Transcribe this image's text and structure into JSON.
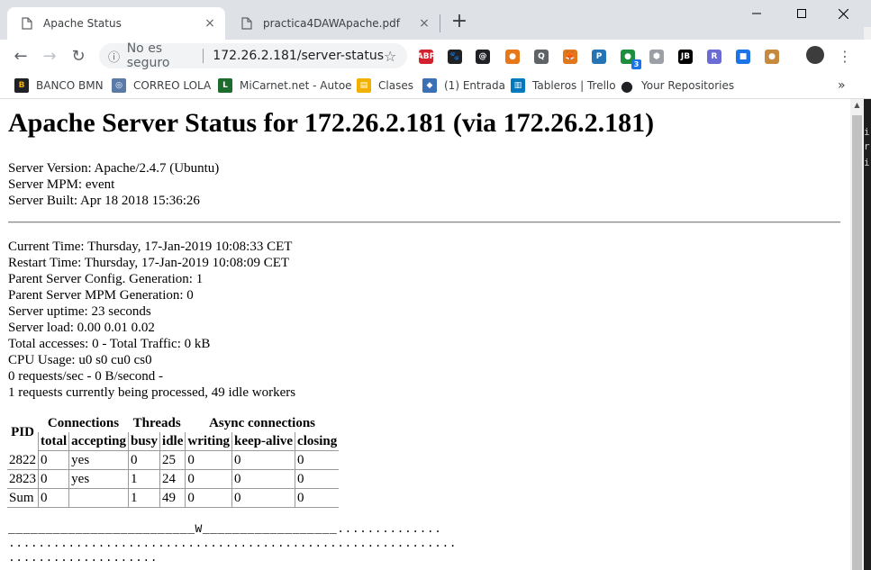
{
  "tabs": [
    {
      "label": "Apache Status",
      "close": "×"
    },
    {
      "label": "practica4DAWApache.pdf",
      "close": "×"
    }
  ],
  "new_tab": "+",
  "window_controls": {
    "minimize": "—",
    "maximize": "☐",
    "close": "✕"
  },
  "toolbar": {
    "back": "←",
    "forward": "→",
    "reload": "↻",
    "security_label": "No es seguro",
    "url": "172.26.2.181/server-status",
    "info_icon": "ⓘ",
    "star": "☆",
    "menu": "⋮",
    "extensions": [
      {
        "name": "adblock-icon",
        "text": "ABP",
        "color": "#d2222d"
      },
      {
        "name": "paw-icon",
        "text": "🐾",
        "color": "#202124"
      },
      {
        "name": "disqus-icon",
        "text": "@",
        "color": "#202124"
      },
      {
        "name": "ball-icon",
        "text": "●",
        "color": "#e8771a"
      },
      {
        "name": "keeper-icon",
        "text": "Q",
        "color": "#5f6368"
      },
      {
        "name": "fox-icon",
        "text": "🦊",
        "color": "#e2761b"
      },
      {
        "name": "pi-icon",
        "text": "P",
        "color": "#2574b5"
      },
      {
        "name": "green-dot-icon",
        "text": "●",
        "color": "#1e8e3e"
      },
      {
        "name": "cube-icon",
        "text": "⬢",
        "color": "#9aa0a6"
      },
      {
        "name": "jb-icon",
        "text": "JB",
        "color": "#000000"
      },
      {
        "name": "r-icon",
        "text": "R",
        "color": "#6b6bd6"
      },
      {
        "name": "camera-icon",
        "text": "■",
        "color": "#1a73e8"
      },
      {
        "name": "cookie-icon",
        "text": "●",
        "color": "#c58a3e"
      }
    ],
    "ext_badge": "3"
  },
  "bookmarks": [
    {
      "label": "BANCO BMN",
      "icon": "B",
      "color": "#202124"
    },
    {
      "label": "CORREO LOLA",
      "icon": "◎",
      "color": "#5b7aa8"
    },
    {
      "label": "MiCarnet.net - Autoe",
      "icon": "L",
      "color": "#1e6b2e"
    },
    {
      "label": "Clases",
      "icon": "▤",
      "color": "#f2b100"
    },
    {
      "label": "(1) Entrada",
      "icon": "◆",
      "color": "#3b6fb6"
    },
    {
      "label": "Tableros | Trello",
      "icon": "▥",
      "color": "#0079bf"
    },
    {
      "label": "Your Repositories",
      "icon": "●",
      "color": "#202124"
    }
  ],
  "bookmarks_more": "»",
  "page": {
    "title": "Apache Server Status for 172.26.2.181 (via 172.26.2.181)",
    "server_info": [
      "Server Version: Apache/2.4.7 (Ubuntu)",
      "Server MPM: event",
      "Server Built: Apr 18 2018 15:36:26"
    ],
    "status_lines": [
      "Current Time: Thursday, 17-Jan-2019 10:08:33 CET",
      "Restart Time: Thursday, 17-Jan-2019 10:08:09 CET",
      "Parent Server Config. Generation: 1",
      "Parent Server MPM Generation: 0",
      "Server uptime: 23 seconds",
      "Server load: 0.00 0.01 0.02",
      "Total accesses: 0 - Total Traffic: 0 kB",
      "CPU Usage: u0 s0 cu0 cs0",
      "0 requests/sec - 0 B/second -",
      "1 requests currently being processed, 49 idle workers"
    ],
    "table": {
      "group_headers": {
        "pid": "PID",
        "connections": "Connections",
        "threads": "Threads",
        "async": "Async connections"
      },
      "sub_headers": [
        "total",
        "accepting",
        "busy",
        "idle",
        "writing",
        "keep-alive",
        "closing"
      ],
      "rows": [
        [
          "2822",
          "0",
          "yes",
          "0",
          "25",
          "0",
          "0",
          "0"
        ],
        [
          "2823",
          "0",
          "yes",
          "1",
          "24",
          "0",
          "0",
          "0"
        ],
        [
          "Sum",
          "0",
          "",
          "1",
          "49",
          "0",
          "0",
          "0"
        ]
      ]
    },
    "scoreboard": [
      "_________________________W__________________..............",
      "............................................................",
      "...................."
    ]
  }
}
